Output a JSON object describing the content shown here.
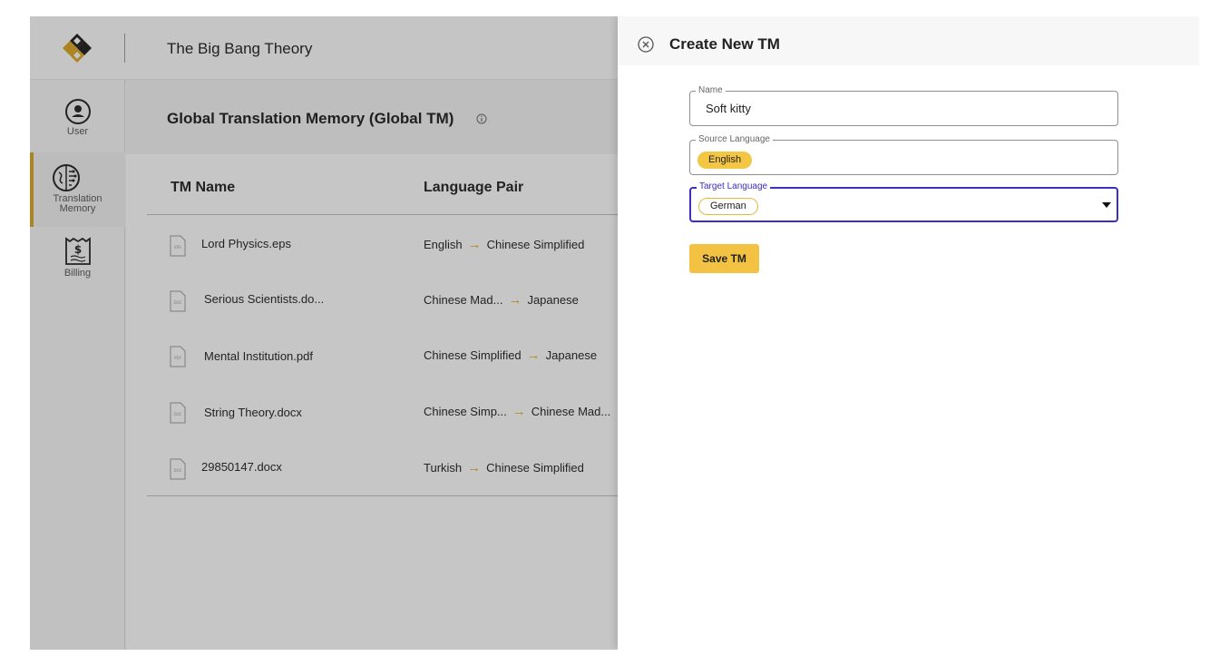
{
  "header": {
    "project_title": "The Big Bang Theory"
  },
  "sidebar": {
    "items": [
      {
        "label": "User",
        "icon": "user-icon",
        "active": false
      },
      {
        "label_line1": "Translation",
        "label_line2": "Memory",
        "icon": "brain-icon",
        "active": true
      },
      {
        "label": "Billing",
        "icon": "billing-icon",
        "active": false
      }
    ]
  },
  "main": {
    "title": "Global Translation Memory (Global TM)",
    "columns": {
      "tm_name": "TM Name",
      "language_pair": "Language Pair"
    },
    "rows": [
      {
        "name": "Lord Physics.eps",
        "source": "English",
        "target": "Chinese Simplified"
      },
      {
        "name": "Serious Scientists.do...",
        "source": "Chinese Mad...",
        "target": "Japanese"
      },
      {
        "name": "Mental Institution.pdf",
        "source": "Chinese Simplified",
        "target": "Japanese"
      },
      {
        "name": "String Theory.docx",
        "source": "Chinese Simp...",
        "target": "Chinese Mad..."
      },
      {
        "name": "29850147.docx",
        "source": "Turkish",
        "target": "Chinese Simplified"
      }
    ]
  },
  "panel": {
    "title": "Create New TM",
    "name_field": {
      "label": "Name",
      "value": "Soft kitty"
    },
    "source_field": {
      "label": "Source Language",
      "chip": "English"
    },
    "target_field": {
      "label": "Target Language",
      "chip": "German"
    },
    "save_label": "Save TM"
  },
  "colors": {
    "accent": "#f4c242",
    "focus": "#3b2ec2",
    "arrow": "#e2a91f"
  }
}
